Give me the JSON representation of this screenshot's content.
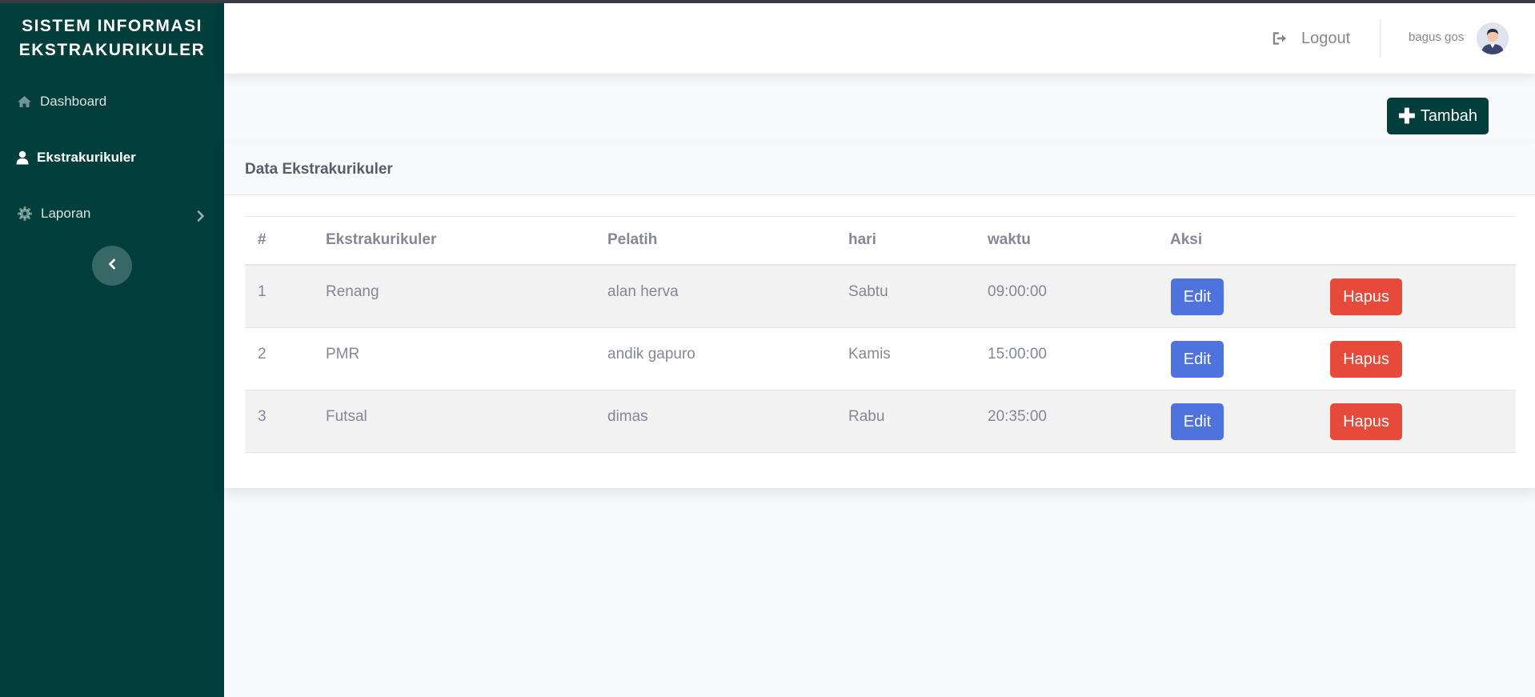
{
  "brand": {
    "line1": "SISTEM INFORMASI",
    "line2": "EKSTRAKURIKULER"
  },
  "sidebar": {
    "items": [
      {
        "label": "Dashboard",
        "icon": "home-icon"
      },
      {
        "label": "Ekstrakurikuler",
        "icon": "user-icon",
        "active": true
      },
      {
        "label": "Laporan",
        "icon": "gear-icon",
        "has_submenu": true
      }
    ],
    "collapse_icon": "chevron-left-icon"
  },
  "topbar": {
    "logout_label": "Logout",
    "user_name": "bagus gos"
  },
  "actions": {
    "add_label": "Tambah"
  },
  "card": {
    "title": "Data Ekstrakurikuler"
  },
  "table": {
    "headers": [
      "#",
      "Ekstrakurikuler",
      "Pelatih",
      "hari",
      "waktu",
      "Aksi"
    ],
    "rows": [
      {
        "no": "1",
        "ekstrakurikuler": "Renang",
        "pelatih": "alan herva",
        "hari": "Sabtu",
        "waktu": "09:00:00"
      },
      {
        "no": "2",
        "ekstrakurikuler": "PMR",
        "pelatih": "andik gapuro",
        "hari": "Kamis",
        "waktu": "15:00:00"
      },
      {
        "no": "3",
        "ekstrakurikuler": "Futsal",
        "pelatih": "dimas",
        "hari": "Rabu",
        "waktu": "20:35:00"
      }
    ],
    "edit_label": "Edit",
    "delete_label": "Hapus"
  },
  "colors": {
    "sidebar": "#013e3c",
    "primary": "#4e73df",
    "danger": "#e74a3b",
    "text_muted": "#858796"
  }
}
